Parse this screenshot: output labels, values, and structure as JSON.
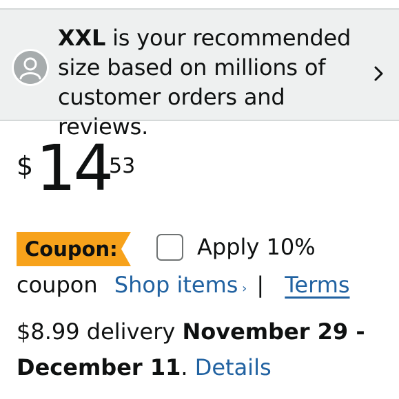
{
  "banner": {
    "size": "XXL",
    "text_line1": " is your recommended",
    "text_line2": "size based on millions of",
    "text_line3": "customer orders and reviews."
  },
  "price": {
    "currency": "$",
    "whole": "14",
    "fraction": "53"
  },
  "coupon": {
    "badge_label": "Coupon:",
    "apply_label": "Apply 10%",
    "apply_continued": "coupon",
    "checked": false,
    "shop_items_label": "Shop items",
    "separator": "|",
    "terms_label": "Terms"
  },
  "delivery": {
    "prefix": "$8.99 delivery ",
    "dates": "November 29 - December 11",
    "period": ". ",
    "details_label": "Details"
  },
  "colors": {
    "banner_bg": "#eef0f0",
    "coupon_badge": "#f7a21b",
    "link": "#2162a1",
    "text": "#0f1111"
  },
  "icons": [
    "user-avatar-icon",
    "chevron-right-icon",
    "chevron-right-small-icon"
  ]
}
